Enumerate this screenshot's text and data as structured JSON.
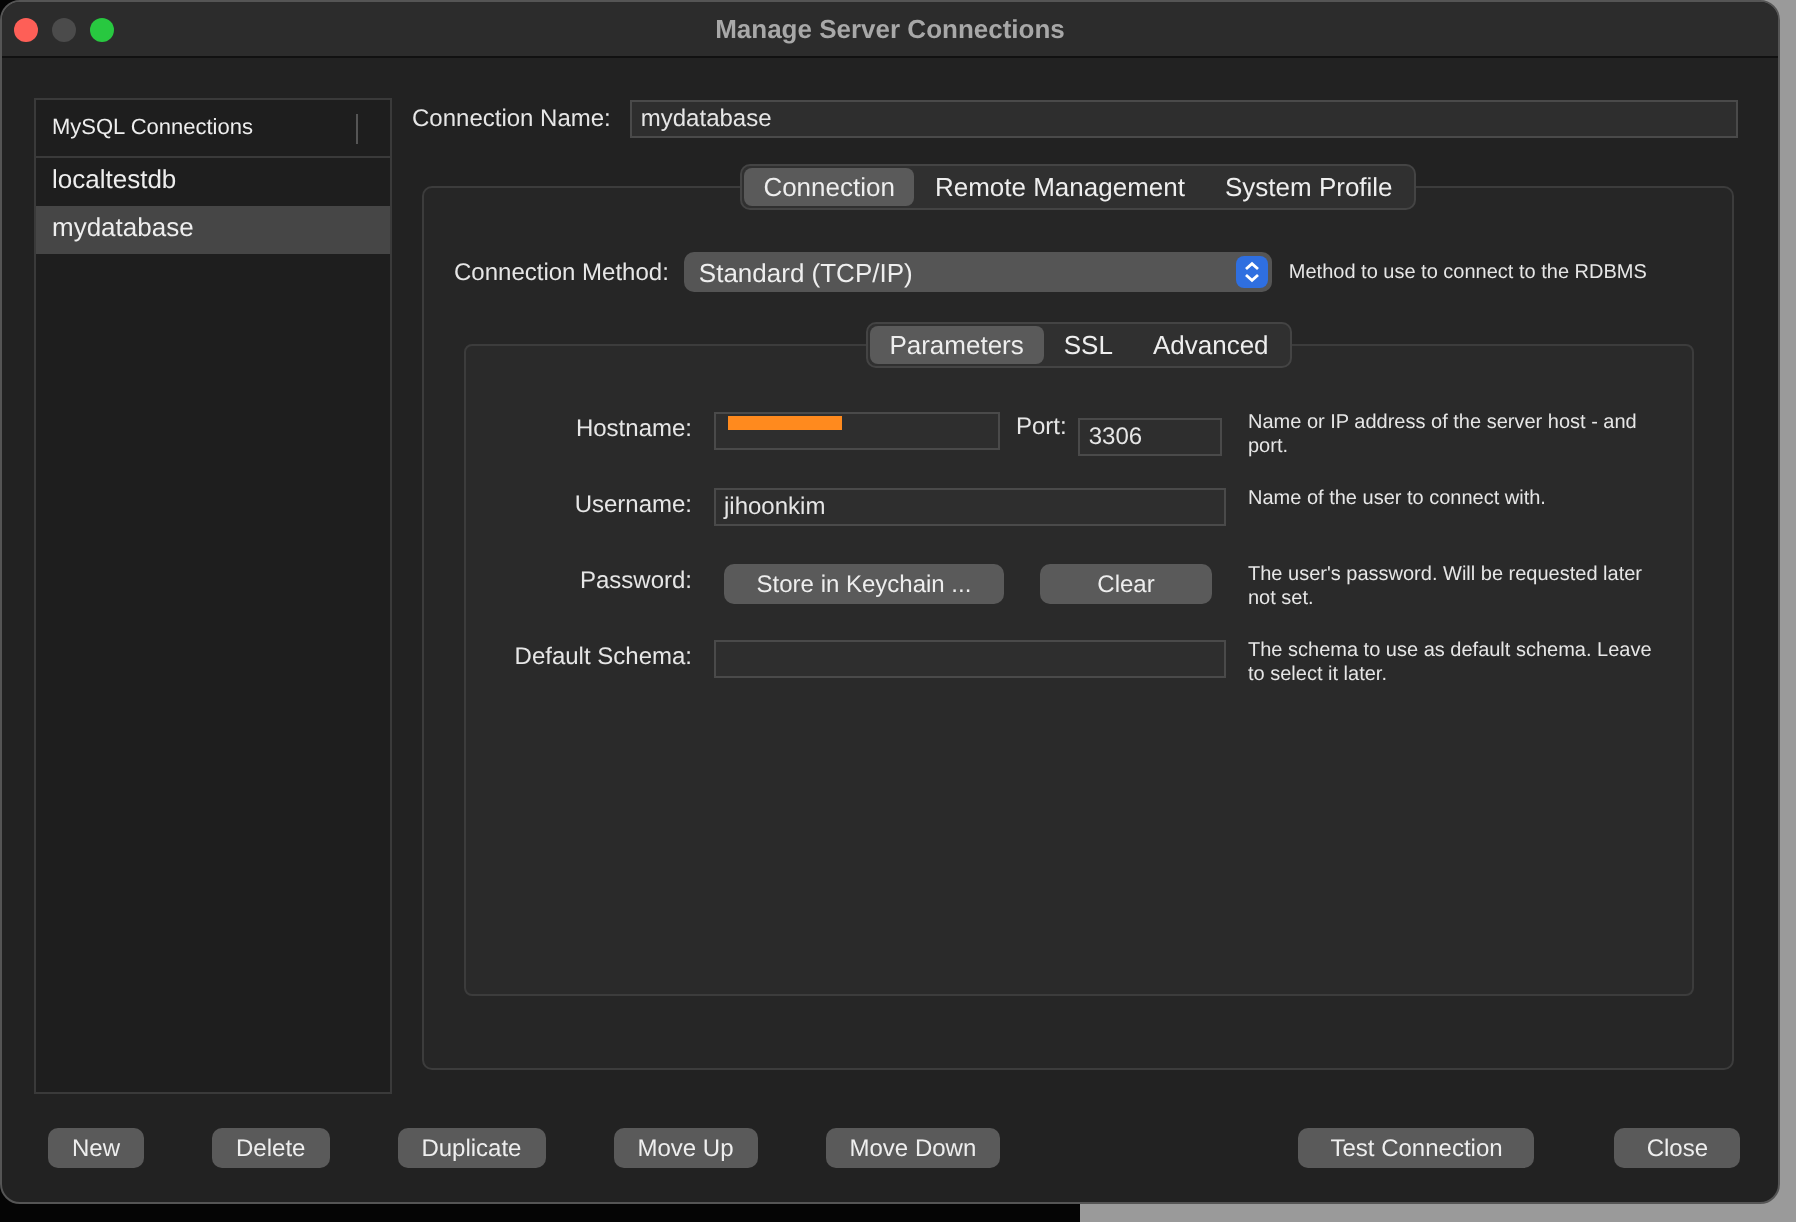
{
  "window": {
    "title": "Manage Server Connections"
  },
  "sidebar": {
    "header": "MySQL Connections",
    "items": [
      {
        "label": "localtestdb",
        "selected": false
      },
      {
        "label": "mydatabase",
        "selected": true
      }
    ]
  },
  "connection_name": {
    "label": "Connection Name:",
    "value": "mydatabase"
  },
  "tabs": [
    {
      "label": "Connection",
      "selected": true
    },
    {
      "label": "Remote Management",
      "selected": false
    },
    {
      "label": "System Profile",
      "selected": false
    }
  ],
  "connection_method": {
    "label": "Connection Method:",
    "value": "Standard (TCP/IP)",
    "help": "Method to use to connect to the RDBMS"
  },
  "subtabs": [
    {
      "label": "Parameters",
      "selected": true
    },
    {
      "label": "SSL",
      "selected": false
    },
    {
      "label": "Advanced",
      "selected": false
    }
  ],
  "parameters": [
    {
      "kind": "host",
      "label": "Hostname:",
      "redacted": true,
      "port_label": "Port:",
      "port_value": "3306",
      "help": "Name or IP address of the server host - and port."
    },
    {
      "kind": "text",
      "label": "Username:",
      "value": "jihoonkim",
      "help": "Name of the user to connect with."
    },
    {
      "kind": "buttons",
      "label": "Password:",
      "buttons": [
        "Store in Keychain ...",
        "Clear"
      ],
      "help": "The user's password. Will be requested later not set."
    },
    {
      "kind": "text",
      "label": "Default Schema:",
      "help": "The schema to use as default schema. Leave to select it later."
    }
  ],
  "buttons_left": [
    "New",
    "Delete",
    "Duplicate",
    "Move Up",
    "Move Down"
  ],
  "buttons_right": [
    "Test Connection",
    "Close"
  ]
}
